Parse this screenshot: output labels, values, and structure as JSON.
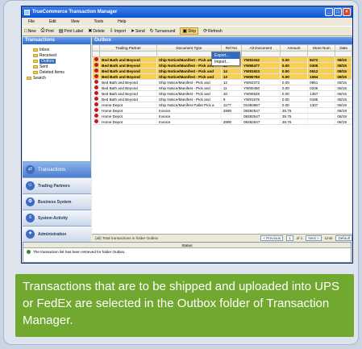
{
  "window": {
    "title": "TrueCommerce Transaction Manager"
  },
  "menu": [
    "File",
    "Edit",
    "View",
    "Tools",
    "Help"
  ],
  "toolbar": [
    {
      "icon": "new-icon",
      "glyph": "□",
      "label": "New"
    },
    {
      "icon": "print-icon",
      "glyph": "⎙",
      "label": "Print"
    },
    {
      "icon": "print-label-icon",
      "glyph": "▤",
      "label": "Print Label"
    },
    {
      "icon": "delete-icon",
      "glyph": "✖",
      "label": "Delete"
    },
    {
      "icon": "import-icon",
      "glyph": "⇩",
      "label": "Import"
    },
    {
      "icon": "send-icon",
      "glyph": "➤",
      "label": "Send"
    },
    {
      "icon": "turnaround-icon",
      "glyph": "↻",
      "label": "Turnaround"
    },
    {
      "icon": "ship-icon",
      "glyph": "▣",
      "label": "Ship"
    },
    {
      "icon": "refresh-icon",
      "glyph": "⟳",
      "label": "Refresh"
    }
  ],
  "left": {
    "header": "Transactions",
    "tree": [
      {
        "label": "Inbox",
        "child": true,
        "selected": false
      },
      {
        "label": "Received",
        "child": true,
        "selected": false
      },
      {
        "label": "Outbox",
        "child": true,
        "selected": true
      },
      {
        "label": "Sent",
        "child": true,
        "selected": false
      },
      {
        "label": "Deleted Items",
        "child": true,
        "selected": false
      },
      {
        "label": "Search",
        "child": false,
        "selected": false
      }
    ],
    "nav": [
      {
        "label": "Transactions",
        "icon": "transactions-icon",
        "active": true
      },
      {
        "label": "Trading Partners",
        "icon": "trading-partners-icon",
        "active": false
      },
      {
        "label": "Business System",
        "icon": "business-system-icon",
        "active": false
      },
      {
        "label": "System Activity",
        "icon": "system-activity-icon",
        "active": false
      },
      {
        "label": "Administration",
        "icon": "administration-icon",
        "active": false
      }
    ]
  },
  "main": {
    "header": "Outbox",
    "columns": [
      "",
      "Trading Partner",
      "Document Type",
      "Ref No",
      "Alt Document",
      "Amount",
      "Store Num",
      "Date"
    ],
    "rows": [
      {
        "hl": true,
        "cells": [
          "Bed Bath and Beyond",
          "Ship Notice/Manifest - Pick and",
          "16",
          "YW81042",
          "0.00",
          "8472",
          "08/15"
        ]
      },
      {
        "hl": true,
        "cells": [
          "Bed Bath and Beyond",
          "Ship Notice/Manifest - Pick and",
          "15",
          "YW80477",
          "0.00",
          "0305",
          "08/15"
        ]
      },
      {
        "hl": true,
        "cells": [
          "Bed Bath and Beyond",
          "Ship Notice/Manifest - Pick and",
          "14",
          "YW81923",
          "0.00",
          "0512",
          "08/15"
        ]
      },
      {
        "hl": true,
        "cells": [
          "Bed Bath and Beyond",
          "Ship Notice/Manifest - Pick and",
          "13",
          "YW80783",
          "0.00",
          "1064",
          "08/15"
        ]
      },
      {
        "hl": false,
        "cells": [
          "Bed Bath and Beyond",
          "Ship Notice/Manifest - Pick and",
          "12",
          "YW82372",
          "0.00",
          "0851",
          "08/15"
        ]
      },
      {
        "hl": false,
        "cells": [
          "Bed Bath and Beyond",
          "Ship Notice/Manifest - Pick and",
          "11",
          "YW80450",
          "0.00",
          "0235",
          "08/15"
        ]
      },
      {
        "hl": false,
        "cells": [
          "Bed Bath and Beyond",
          "Ship Notice/Manifest - Pick and",
          "10",
          "YW80628",
          "0.00",
          "1367",
          "08/15"
        ]
      },
      {
        "hl": false,
        "cells": [
          "Bed Bath and Beyond",
          "Ship Notice/Manifest - Pick and",
          "9",
          "YW91576",
          "0.00",
          "0185",
          "08/15"
        ]
      },
      {
        "hl": false,
        "plain": true,
        "cells": [
          "Home Depot",
          "Ship Notice/Manifest Pallet Pick a",
          "1177",
          "01083687",
          "0.00",
          "1307",
          "08/19"
        ]
      },
      {
        "hl": false,
        "plain": true,
        "cells": [
          "Home Depot",
          "Invoice",
          "2890",
          "09382547",
          "35.75",
          "",
          "08/19"
        ]
      },
      {
        "hl": false,
        "plain": true,
        "cells": [
          "Home Depot",
          "Invoice",
          "",
          "09382547",
          "35.75",
          "",
          "08/19"
        ]
      },
      {
        "hl": false,
        "plain": true,
        "cells": [
          "Home Depot",
          "Invoice",
          "2890",
          "09382547",
          "35.75",
          "",
          "08/19"
        ]
      }
    ],
    "dropdown": [
      "Export...",
      "Import..."
    ]
  },
  "pager": {
    "summary": "(all) Total transactions in folder Outbox",
    "prev": "< Previous",
    "page": "1",
    "of": "of 1",
    "next": "Next >",
    "limit_label": "Limit",
    "limit": "Default"
  },
  "status": {
    "header": "Status",
    "message": "The transaction list has been retrieved for folder Outbox."
  },
  "caption": "Transactions that are to be shipped and uploaded into UPS or FedEx are selected in the Outbox folder of Transaction Manager."
}
